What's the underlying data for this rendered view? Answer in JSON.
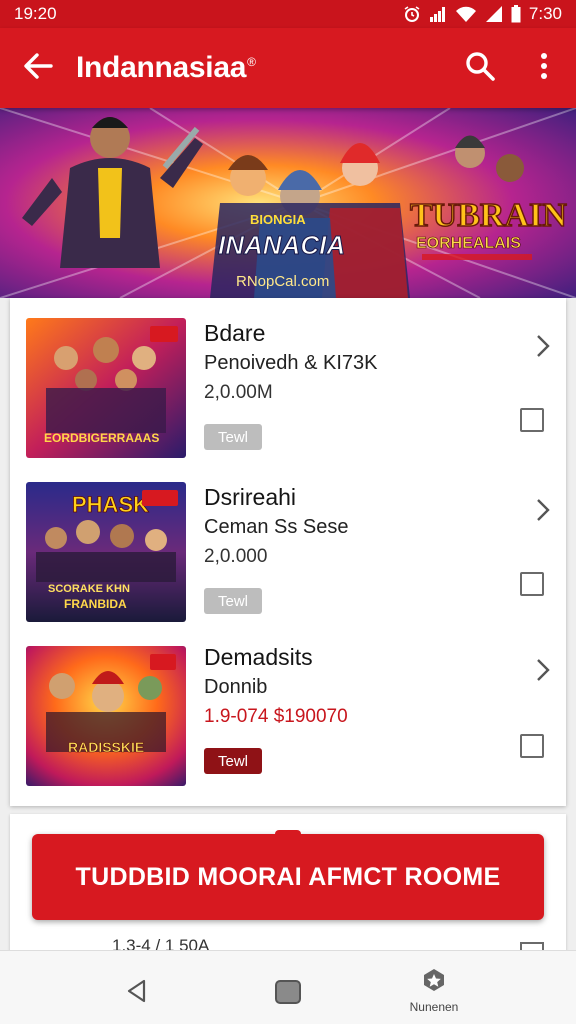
{
  "status_bar": {
    "time_left": "19:20",
    "time_right": "7:30"
  },
  "app_bar": {
    "title": "Indannasiaa",
    "title_mark": "®"
  },
  "banner": {
    "title_left": "INANACIA",
    "small_line": "BIONGIA",
    "url": "RNopCal.com",
    "title_right_1": "TUBRAIN",
    "title_right_2": "EORHEALAIS"
  },
  "items": [
    {
      "name": "Bdare",
      "sub": "Penoivedh & KI73K",
      "price": "2,0.00M",
      "tag": "Tewl",
      "thumb_text": "EORDBIGERRAAAS",
      "badge": ""
    },
    {
      "name": "Dsrireahi",
      "sub": "Ceman Ss Sese",
      "price": "2,0.000",
      "tag": "Tewl",
      "thumb_text": "SCORAKE KHN",
      "thumb_text_2": "FRANBIDA",
      "thumb_title": "PHASK",
      "badge": ""
    },
    {
      "name": "Demadsits",
      "sub": "Donnib",
      "price": "1.9-074 $190070",
      "tag": "Tewl",
      "thumb_text": "RADISSKIE",
      "badge": ""
    }
  ],
  "cta": {
    "label": "TUDDBID MOORAI AFMCT ROOME"
  },
  "peek": {
    "text": "1,3-4 / 1 50A"
  },
  "nav": {
    "extra_label": "Nunenen"
  },
  "colors": {
    "primary": "#d71920",
    "status": "#c9141c",
    "tag_grey": "#bdbdbd",
    "tag_dark": "#8f1216",
    "price_red": "#c8161d"
  },
  "icons": {
    "back": "arrow-left-icon",
    "search": "search-icon",
    "more": "more-vertical-icon",
    "chevron": "chevron-right-icon",
    "nav_back": "triangle-back-icon",
    "nav_home": "square-home-icon",
    "nav_extra": "star-badge-icon"
  }
}
